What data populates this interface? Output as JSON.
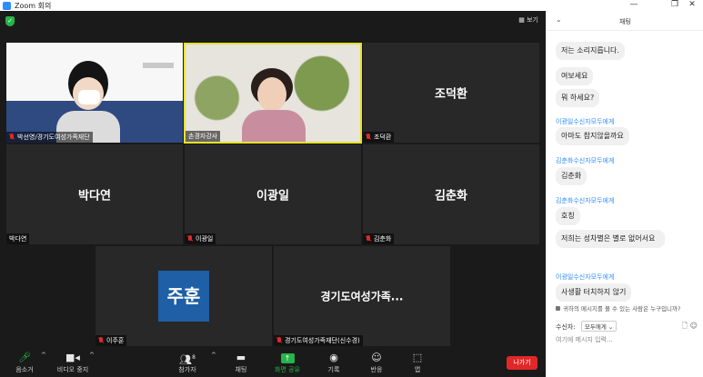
{
  "window": {
    "title": "Zoom 회의",
    "minimize": "—",
    "restore": "❐",
    "close": "✕"
  },
  "topbar": {
    "security_icon": "shield-icon",
    "view_label": "▦ 보기"
  },
  "tiles": [
    {
      "name": "",
      "label": "박선영/경기도여성가족재단",
      "muted": true
    },
    {
      "name": "",
      "label": "손경자강사",
      "muted": false
    },
    {
      "name": "조덕환",
      "label": "조덕환",
      "muted": true
    },
    {
      "name": "박다연",
      "label": "박다연",
      "muted": false
    },
    {
      "name": "이광일",
      "label": "이광일",
      "muted": true
    },
    {
      "name": "김춘화",
      "label": "김춘화",
      "muted": true
    },
    {
      "name": "주훈",
      "label": "이주훈",
      "muted": true
    },
    {
      "name": "경기도여성가족...",
      "label": "경기도여성가족재단(신수경)",
      "muted": true
    }
  ],
  "toolbar": {
    "audio": "음소거",
    "video": "비디오 중지",
    "participants": "참가자",
    "participants_count": "8",
    "chat": "채팅",
    "share": "화면 공유",
    "record": "기록",
    "reactions": "반응",
    "apps": "앱",
    "leave": "나가기"
  },
  "chat": {
    "title": "채팅",
    "messages": [
      {
        "sender": "",
        "text": "저는 소리지릅니다."
      },
      {
        "sender": "",
        "text": "여보세요"
      },
      {
        "sender": "",
        "text": "뭐 하세요?"
      },
      {
        "sender": "이광일수신자모두에게",
        "text": "아마도 참지않을까요"
      },
      {
        "sender": "김춘화수신자모두에게",
        "text": "김춘화"
      },
      {
        "sender": "김춘화수신자모두에게",
        "text": "호칭"
      },
      {
        "sender": "",
        "text": "저희는 성차별은 별로 없어서요"
      },
      {
        "sender": "이광일수신자모두에게",
        "text": "사생활 터치하지 않기"
      }
    ],
    "notice": "귀하의 메시지를 볼 수 있는 사람은 누구입니까?",
    "recipient_label": "수신자:",
    "recipient_value": "모두에게 ⌄",
    "input_placeholder": "여기에 메시지 입력..."
  }
}
